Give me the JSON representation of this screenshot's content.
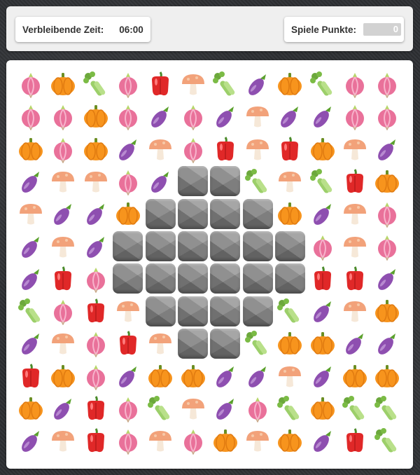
{
  "header": {
    "time_label": "Verbleibende Zeit:",
    "time_value": "06:00",
    "score_label": "Spiele Punkte:",
    "score_value": "0"
  },
  "board": {
    "rows": 12,
    "cols": 12,
    "grid": [
      [
        "onion",
        "pumpkin",
        "celery",
        "onion",
        "pepper",
        "mushroom",
        "celery",
        "eggplant",
        "pumpkin",
        "celery",
        "onion",
        "onion"
      ],
      [
        "onion",
        "onion",
        "pumpkin",
        "onion",
        "eggplant",
        "onion",
        "eggplant",
        "mushroom",
        "eggplant",
        "eggplant",
        "onion",
        "onion"
      ],
      [
        "pumpkin",
        "onion",
        "pumpkin",
        "eggplant",
        "mushroom",
        "onion",
        "pepper",
        "mushroom",
        "pepper",
        "pumpkin",
        "mushroom",
        "eggplant"
      ],
      [
        "eggplant",
        "mushroom",
        "mushroom",
        "onion",
        "eggplant",
        "rock",
        "rock",
        "celery",
        "mushroom",
        "celery",
        "pepper",
        "pumpkin"
      ],
      [
        "mushroom",
        "eggplant",
        "eggplant",
        "pumpkin",
        "rock",
        "rock",
        "rock",
        "rock",
        "pumpkin",
        "eggplant",
        "mushroom",
        "onion"
      ],
      [
        "eggplant",
        "mushroom",
        "eggplant",
        "rock",
        "rock",
        "rock",
        "rock",
        "rock",
        "rock",
        "onion",
        "mushroom",
        "onion"
      ],
      [
        "eggplant",
        "pepper",
        "onion",
        "rock",
        "rock",
        "rock",
        "rock",
        "rock",
        "rock",
        "pepper",
        "pepper",
        "eggplant"
      ],
      [
        "celery",
        "onion",
        "pepper",
        "mushroom",
        "rock",
        "rock",
        "rock",
        "rock",
        "celery",
        "eggplant",
        "mushroom",
        "pumpkin"
      ],
      [
        "eggplant",
        "mushroom",
        "onion",
        "pepper",
        "mushroom",
        "rock",
        "rock",
        "celery",
        "pumpkin",
        "pumpkin",
        "eggplant",
        "eggplant"
      ],
      [
        "pepper",
        "pumpkin",
        "onion",
        "eggplant",
        "pumpkin",
        "pumpkin",
        "eggplant",
        "eggplant",
        "mushroom",
        "eggplant",
        "pumpkin",
        "pumpkin"
      ],
      [
        "pumpkin",
        "eggplant",
        "pepper",
        "onion",
        "celery",
        "mushroom",
        "eggplant",
        "onion",
        "celery",
        "pumpkin",
        "celery",
        "celery"
      ],
      [
        "eggplant",
        "mushroom",
        "pepper",
        "onion",
        "mushroom",
        "onion",
        "pumpkin",
        "mushroom",
        "pumpkin",
        "eggplant",
        "pepper",
        "celery"
      ]
    ]
  },
  "colors": {
    "onion": "#e9719a",
    "pumpkin": "#f7941d",
    "celery": "#9ccf6a",
    "pepper": "#e02828",
    "mushroom": "#f2a27a",
    "eggplant": "#8e4fb0",
    "rock": "#8a8a8a"
  }
}
